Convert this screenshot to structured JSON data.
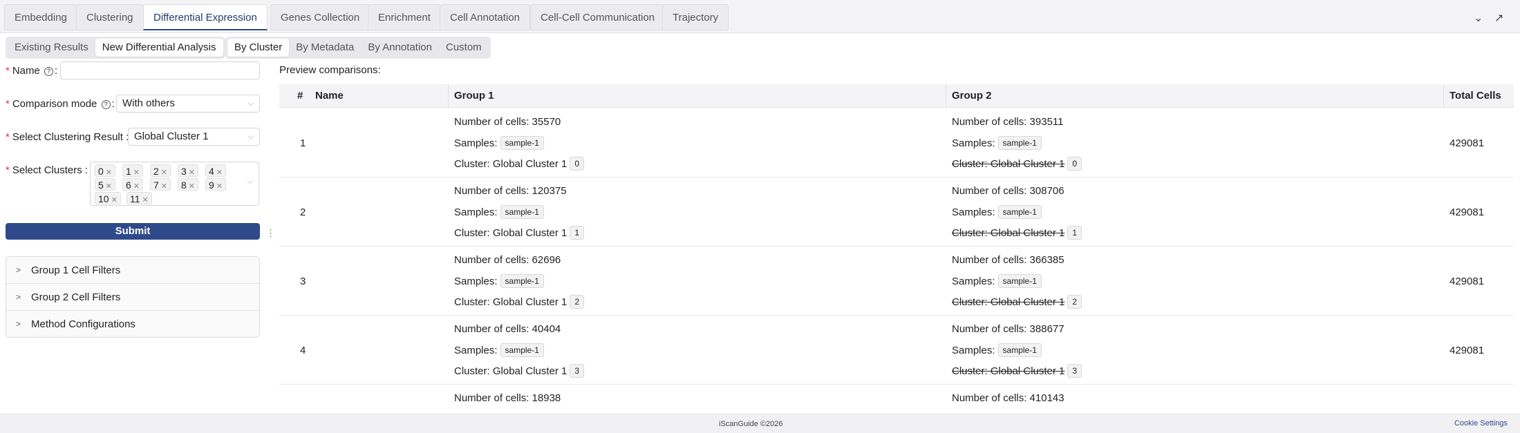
{
  "top_tabs": [
    "Embedding",
    "Clustering",
    "Differential Expression",
    "Genes Collection",
    "Enrichment",
    "Cell Annotation",
    "Cell-Cell Communication",
    "Trajectory"
  ],
  "active_top_tab": "Differential Expression",
  "mode_tabs": [
    "Existing Results",
    "New Differential Analysis"
  ],
  "by_tabs": [
    "By Cluster",
    "By Metadata",
    "By Annotation",
    "Custom"
  ],
  "form": {
    "name_label": "Name",
    "name_value": "",
    "comparison_label": "Comparison mode",
    "comparison_value": "With others",
    "clustering_label": "Select Clustering Result",
    "clustering_value": "Global Cluster 1",
    "clusters_label": "Select Clusters",
    "clusters": [
      "0",
      "1",
      "2",
      "3",
      "4",
      "5",
      "6",
      "7",
      "8",
      "9",
      "10",
      "11"
    ],
    "submit_label": "Submit"
  },
  "collapsibles": [
    "Group 1 Cell Filters",
    "Group 2 Cell Filters",
    "Method Configurations"
  ],
  "preview": {
    "title": "Preview comparisons:",
    "headers": [
      "#",
      "Name",
      "Group 1",
      "Group 2",
      "Total Cells"
    ],
    "rows": [
      {
        "num": "1",
        "g1_cells": "Number of cells: 35570",
        "g1_samples": "Samples:",
        "g1_sample": "sample-1",
        "g1_cluster": "Cluster: Global Cluster 1",
        "g1_tag": "0",
        "g2_cells": "Number of cells: 393511",
        "g2_samples": "Samples:",
        "g2_sample": "sample-1",
        "g2_cluster": "Cluster: Global Cluster 1",
        "g2_tag": "0",
        "total": "429081"
      },
      {
        "num": "2",
        "g1_cells": "Number of cells: 120375",
        "g1_samples": "Samples:",
        "g1_sample": "sample-1",
        "g1_cluster": "Cluster: Global Cluster 1",
        "g1_tag": "1",
        "g2_cells": "Number of cells: 308706",
        "g2_samples": "Samples:",
        "g2_sample": "sample-1",
        "g2_cluster": "Cluster: Global Cluster 1",
        "g2_tag": "1",
        "total": "429081"
      },
      {
        "num": "3",
        "g1_cells": "Number of cells: 62696",
        "g1_samples": "Samples:",
        "g1_sample": "sample-1",
        "g1_cluster": "Cluster: Global Cluster 1",
        "g1_tag": "2",
        "g2_cells": "Number of cells: 366385",
        "g2_samples": "Samples:",
        "g2_sample": "sample-1",
        "g2_cluster": "Cluster: Global Cluster 1",
        "g2_tag": "2",
        "total": "429081"
      },
      {
        "num": "4",
        "g1_cells": "Number of cells: 40404",
        "g1_samples": "Samples:",
        "g1_sample": "sample-1",
        "g1_cluster": "Cluster: Global Cluster 1",
        "g1_tag": "3",
        "g2_cells": "Number of cells: 388677",
        "g2_samples": "Samples:",
        "g2_sample": "sample-1",
        "g2_cluster": "Cluster: Global Cluster 1",
        "g2_tag": "3",
        "total": "429081"
      },
      {
        "num": "",
        "g1_cells": "Number of cells: 18938",
        "g2_cells": "Number of cells: 410143"
      }
    ]
  },
  "footer": {
    "brand": "iScanGuide ©2026",
    "link": "Cookie Settings"
  }
}
